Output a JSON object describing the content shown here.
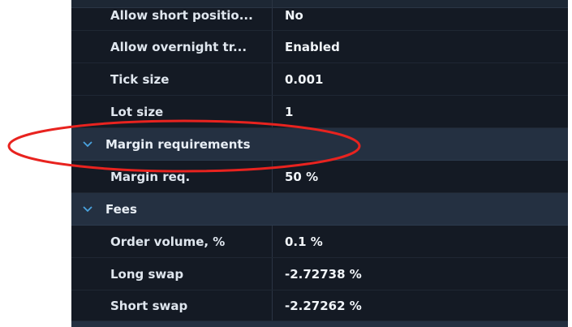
{
  "rows_top": [
    {
      "label": "Allow short positio...",
      "value": "No"
    },
    {
      "label": "Allow overnight tr...",
      "value": "Enabled"
    },
    {
      "label": "Tick size",
      "value": "0.001"
    },
    {
      "label": "Lot size",
      "value": "1"
    }
  ],
  "sections": {
    "margin": {
      "title": "Margin requirements",
      "rows": [
        {
          "label": "Margin req.",
          "value": "50 %"
        }
      ]
    },
    "fees": {
      "title": "Fees",
      "rows": [
        {
          "label": "Order volume, %",
          "value": "0.1 %"
        },
        {
          "label": "Long swap",
          "value": "-2.72738 %"
        },
        {
          "label": "Short swap",
          "value": "-2.27262 %"
        }
      ]
    }
  },
  "icons": {
    "section_toggle": "chevron-down-icon"
  },
  "colors": {
    "panel_bg": "#141a24",
    "section_bg": "#243041",
    "chevron": "#4aa3df",
    "annotation": "#e8231f"
  }
}
